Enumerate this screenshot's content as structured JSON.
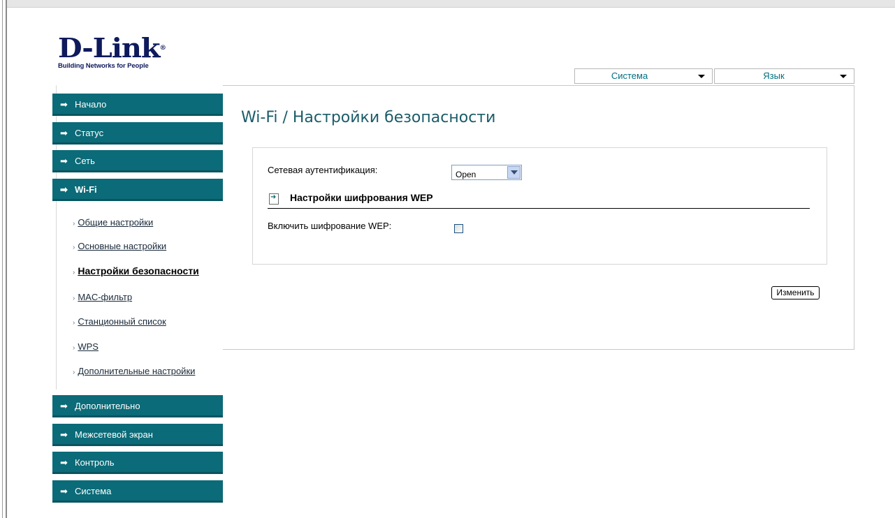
{
  "logo": {
    "brand": "D-Link",
    "tagline": "Building Networks for People"
  },
  "top_menus": [
    {
      "label": "Система"
    },
    {
      "label": "Язык"
    }
  ],
  "nav": [
    {
      "label": "Начало"
    },
    {
      "label": "Статус"
    },
    {
      "label": "Сеть"
    },
    {
      "label": "Wi-Fi"
    },
    {
      "label": "Дополнительно"
    },
    {
      "label": "Межсетевой экран"
    },
    {
      "label": "Контроль"
    },
    {
      "label": "Система"
    }
  ],
  "wifi_sub": [
    {
      "label": "Общие настройки"
    },
    {
      "label": "Основные настройки"
    },
    {
      "label": "Настройки безопасности"
    },
    {
      "label": "MAC-фильтр"
    },
    {
      "label": "Станционный список"
    },
    {
      "label": "WPS"
    },
    {
      "label": "Дополнительные настройки"
    }
  ],
  "page": {
    "title": "Wi-Fi / Настройки безопасности",
    "auth_label": "Сетевая аутентификация:",
    "auth_value": "Open",
    "section_title": "Настройки шифрования WEP",
    "wep_label": "Включить шифрование WEP:",
    "wep_enabled": false,
    "apply_label": "Изменить"
  },
  "colors": {
    "nav_bg": "#0b6b78",
    "title": "#1a5c68",
    "brand": "#0e1a5c"
  }
}
